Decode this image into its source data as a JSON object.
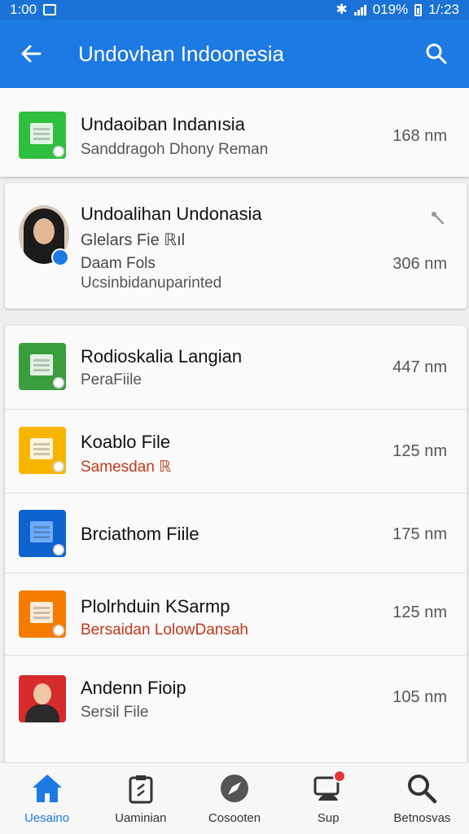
{
  "status_bar": {
    "time_left": "1:00",
    "battery": "019%",
    "time_right": "1/:23"
  },
  "app_bar": {
    "title": "Undovhan Indoonesia",
    "back_icon": "arrow-back-icon",
    "search_icon": "search-icon"
  },
  "files": [
    {
      "title": "Undaoiban Indanısia",
      "subtitle": "Sanddragoh Dhony Reman",
      "size": "168 nm",
      "color": "#2fbf3e"
    },
    {
      "title": "Undoalihan Undonasia",
      "subtitle": "Glelars Fie ℝıl",
      "subtitle2": "Daam Fols",
      "subtitle3": "Ucsinbidanuparinted",
      "size": "306 nm"
    },
    {
      "title": "Rodioskalia Langian",
      "subtitle": "PeraFiile",
      "size": "447 nm",
      "color": "#3a9e3f"
    },
    {
      "title": "Koablo File",
      "subtitle": "Samesdan ℝ",
      "size": "125 nm",
      "color": "#f7b500",
      "subtitle_color": "#c0391a"
    },
    {
      "title": "Brciathom Fiile",
      "size": "175 nm",
      "color": "#0e63cf"
    },
    {
      "title": "Plolrhduin KSarmp",
      "subtitle": "Bersaidan LolowDansah",
      "size": "125 nm",
      "color": "#f57c00",
      "subtitle_color": "#c0391a"
    },
    {
      "title": "Andenn Fioip",
      "subtitle": "Sersil File",
      "size": "105 nm"
    }
  ],
  "bottom_nav": [
    {
      "label": "Uesaino",
      "icon": "home-icon",
      "active": true
    },
    {
      "label": "Uaminian",
      "icon": "document-icon"
    },
    {
      "label": "Cosooten",
      "icon": "compass-icon"
    },
    {
      "label": "Sup",
      "icon": "support-icon",
      "badge": true
    },
    {
      "label": "Betnosvas",
      "icon": "search-icon"
    }
  ]
}
